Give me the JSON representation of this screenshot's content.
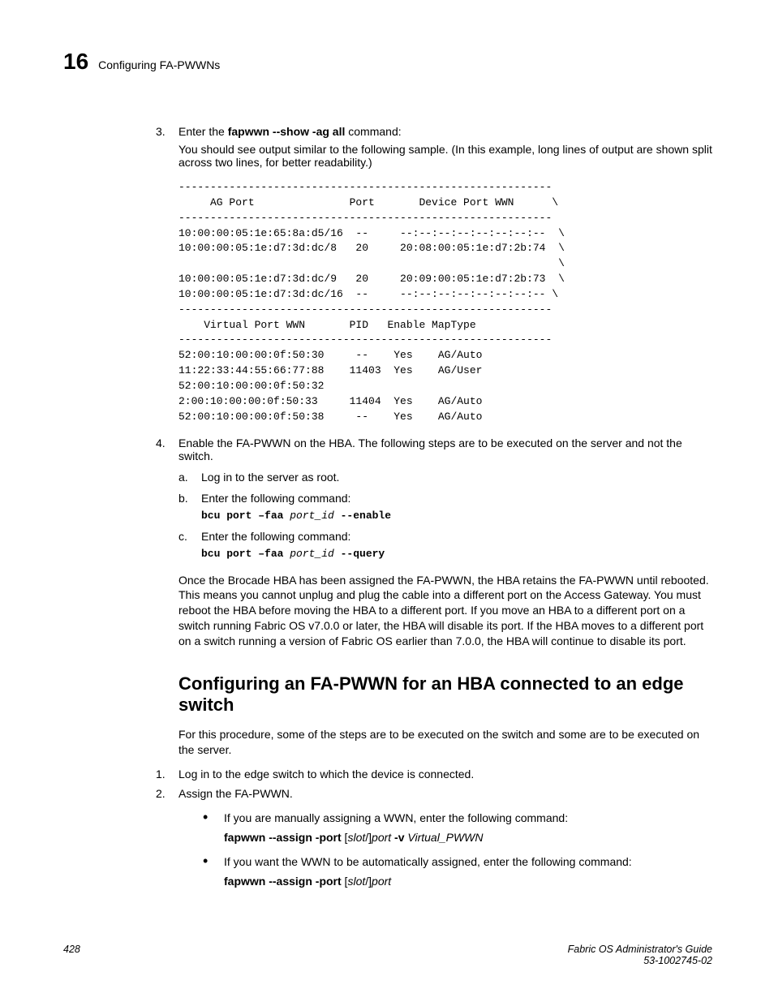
{
  "header": {
    "chapter_number": "16",
    "chapter_title": "Configuring FA-PWWNs"
  },
  "steps": {
    "s3": {
      "num": "3.",
      "prefix": "Enter the ",
      "cmd": "fapwwn --show -ag all",
      "suffix": " command:",
      "note": "You should see output similar to the following sample. (In this example, long lines of output are shown split across two lines, for better readability.)",
      "output": "-----------------------------------------------------------\n     AG Port               Port       Device Port WWN      \\\n-----------------------------------------------------------\n10:00:00:05:1e:65:8a:d5/16  --     --:--:--:--:--:--:--:--  \\\n10:00:00:05:1e:d7:3d:dc/8   20     20:08:00:05:1e:d7:2b:74  \\\n                                                            \\\n10:00:00:05:1e:d7:3d:dc/9   20     20:09:00:05:1e:d7:2b:73  \\\n10:00:00:05:1e:d7:3d:dc/16  --     --:--:--:--:--:--:--:-- \\\n-----------------------------------------------------------\n    Virtual Port WWN       PID   Enable MapType\n-----------------------------------------------------------\n52:00:10:00:00:0f:50:30     --    Yes    AG/Auto\n11:22:33:44:55:66:77:88    11403  Yes    AG/User\n52:00:10:00:00:0f:50:32\n2:00:10:00:00:0f:50:33     11404  Yes    AG/Auto\n52:00:10:00:00:0f:50:38     --    Yes    AG/Auto"
    },
    "s4": {
      "num": "4.",
      "text": "Enable the FA-PWWN on the HBA. The following steps are to be executed on the server and not the switch.",
      "a": {
        "mark": "a.",
        "text": "Log in to the server as root."
      },
      "b": {
        "mark": "b.",
        "text": "Enter the following command:",
        "cmd_pre": "bcu port –faa ",
        "cmd_arg": "port_id",
        "cmd_post": " --enable"
      },
      "c": {
        "mark": "c.",
        "text": "Enter the following command:",
        "cmd_pre": "bcu port –faa ",
        "cmd_arg": "port_id",
        "cmd_post": " --query"
      }
    }
  },
  "paragraph_after": "Once the Brocade HBA has been assigned the FA-PWWN, the HBA retains the FA-PWWN until rebooted. This means you cannot unplug and plug the cable into a different port on the Access Gateway. You must reboot the HBA before moving the HBA to a different port. If you move an HBA to a different port on a switch running Fabric OS v7.0.0 or later, the HBA will disable its port. If the HBA moves to a different port on a switch running a version of Fabric OS earlier than 7.0.0, the HBA will continue to disable its port.",
  "section2": {
    "title": "Configuring an FA-PWWN for an HBA connected to an edge switch",
    "intro": "For this procedure, some of the steps are to be executed on the switch and some are to be executed on the server.",
    "s1": {
      "num": "1.",
      "text": "Log in to the edge switch to which the device is connected."
    },
    "s2": {
      "num": "2.",
      "text": "Assign the FA-PWWN.",
      "b1": {
        "text": "If you are manually assigning a WWN, enter the following command:",
        "cmd_bold1": "fapwwn --assign -port",
        "cmd_mid1": " [",
        "cmd_it1": "slot",
        "cmd_mid2": "/]",
        "cmd_it2": "port",
        "cmd_mid3": " -v ",
        "cmd_it3": "Virtual_PWWN"
      },
      "b2": {
        "text": "If you want the WWN to be automatically assigned, enter the following command:",
        "cmd_bold1": "fapwwn --assign -port",
        "cmd_mid1": " [",
        "cmd_it1": "slot",
        "cmd_mid2": "/]",
        "cmd_it2": "port"
      }
    }
  },
  "footer": {
    "page": "428",
    "doc_title": "Fabric OS Administrator's Guide",
    "doc_num": "53-1002745-02"
  }
}
